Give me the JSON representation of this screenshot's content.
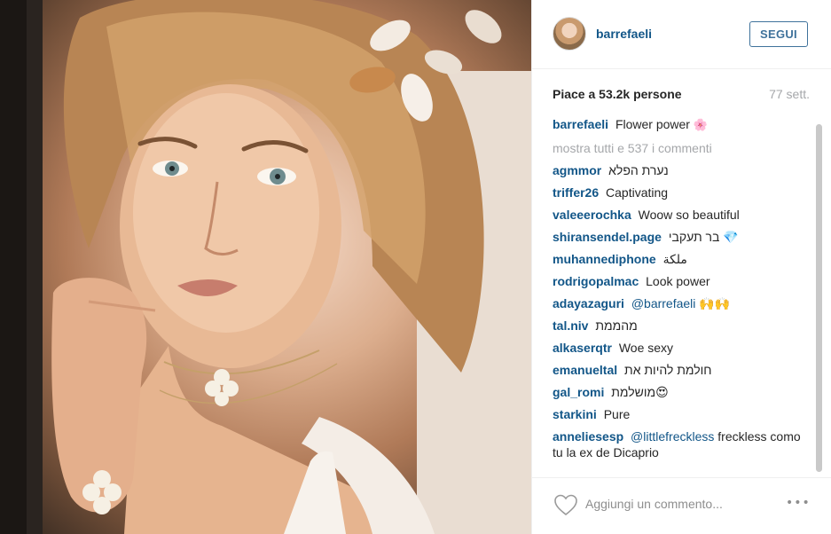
{
  "post": {
    "photo_alt": "Portrait photo"
  },
  "header": {
    "username": "barrefaeli",
    "follow_label": "SEGUI"
  },
  "stats": {
    "likes": "Piace a 53.2k persone",
    "time": "77 sett."
  },
  "caption": {
    "user": "barrefaeli",
    "text": "Flower power",
    "emoji": "🌸"
  },
  "more_comments": "mostra tutti e 537 i commenti",
  "comments": [
    {
      "user": "agmmor",
      "text": "נערת הפלא"
    },
    {
      "user": "triffer26",
      "text": "Captivating"
    },
    {
      "user": "valeeerochka",
      "text": "Woow so beautiful"
    },
    {
      "user": "shiransendel.page",
      "text": "בר תעקבי 💎"
    },
    {
      "user": "muhannediphone",
      "text": "ملكة"
    },
    {
      "user": "rodrigopalmac",
      "text": "Look power"
    },
    {
      "user": "adayazaguri",
      "text": "@barrefaeli 🙌🙌"
    },
    {
      "user": "tal.niv",
      "text": "מהממת"
    },
    {
      "user": "alkaserqtr",
      "text": "Woe sexy"
    },
    {
      "user": "emanueltal",
      "text": "חולמת להיות את"
    },
    {
      "user": "gal_romi",
      "text": "מושלמת😍"
    },
    {
      "user": "starkini",
      "text": "Pure"
    },
    {
      "user": "anneliesesp",
      "text": "@littlefreckless freckless como tu la ex de Dicaprio"
    }
  ],
  "footer": {
    "placeholder": "Aggiungi un commento...",
    "more_icon": "•••"
  },
  "colors": {
    "link_blue": "#125688",
    "button_blue": "#3f729b",
    "muted_gray": "#a5a7aa"
  },
  "icons": {
    "like": "heart-outline-icon",
    "options": "ellipsis-icon"
  }
}
